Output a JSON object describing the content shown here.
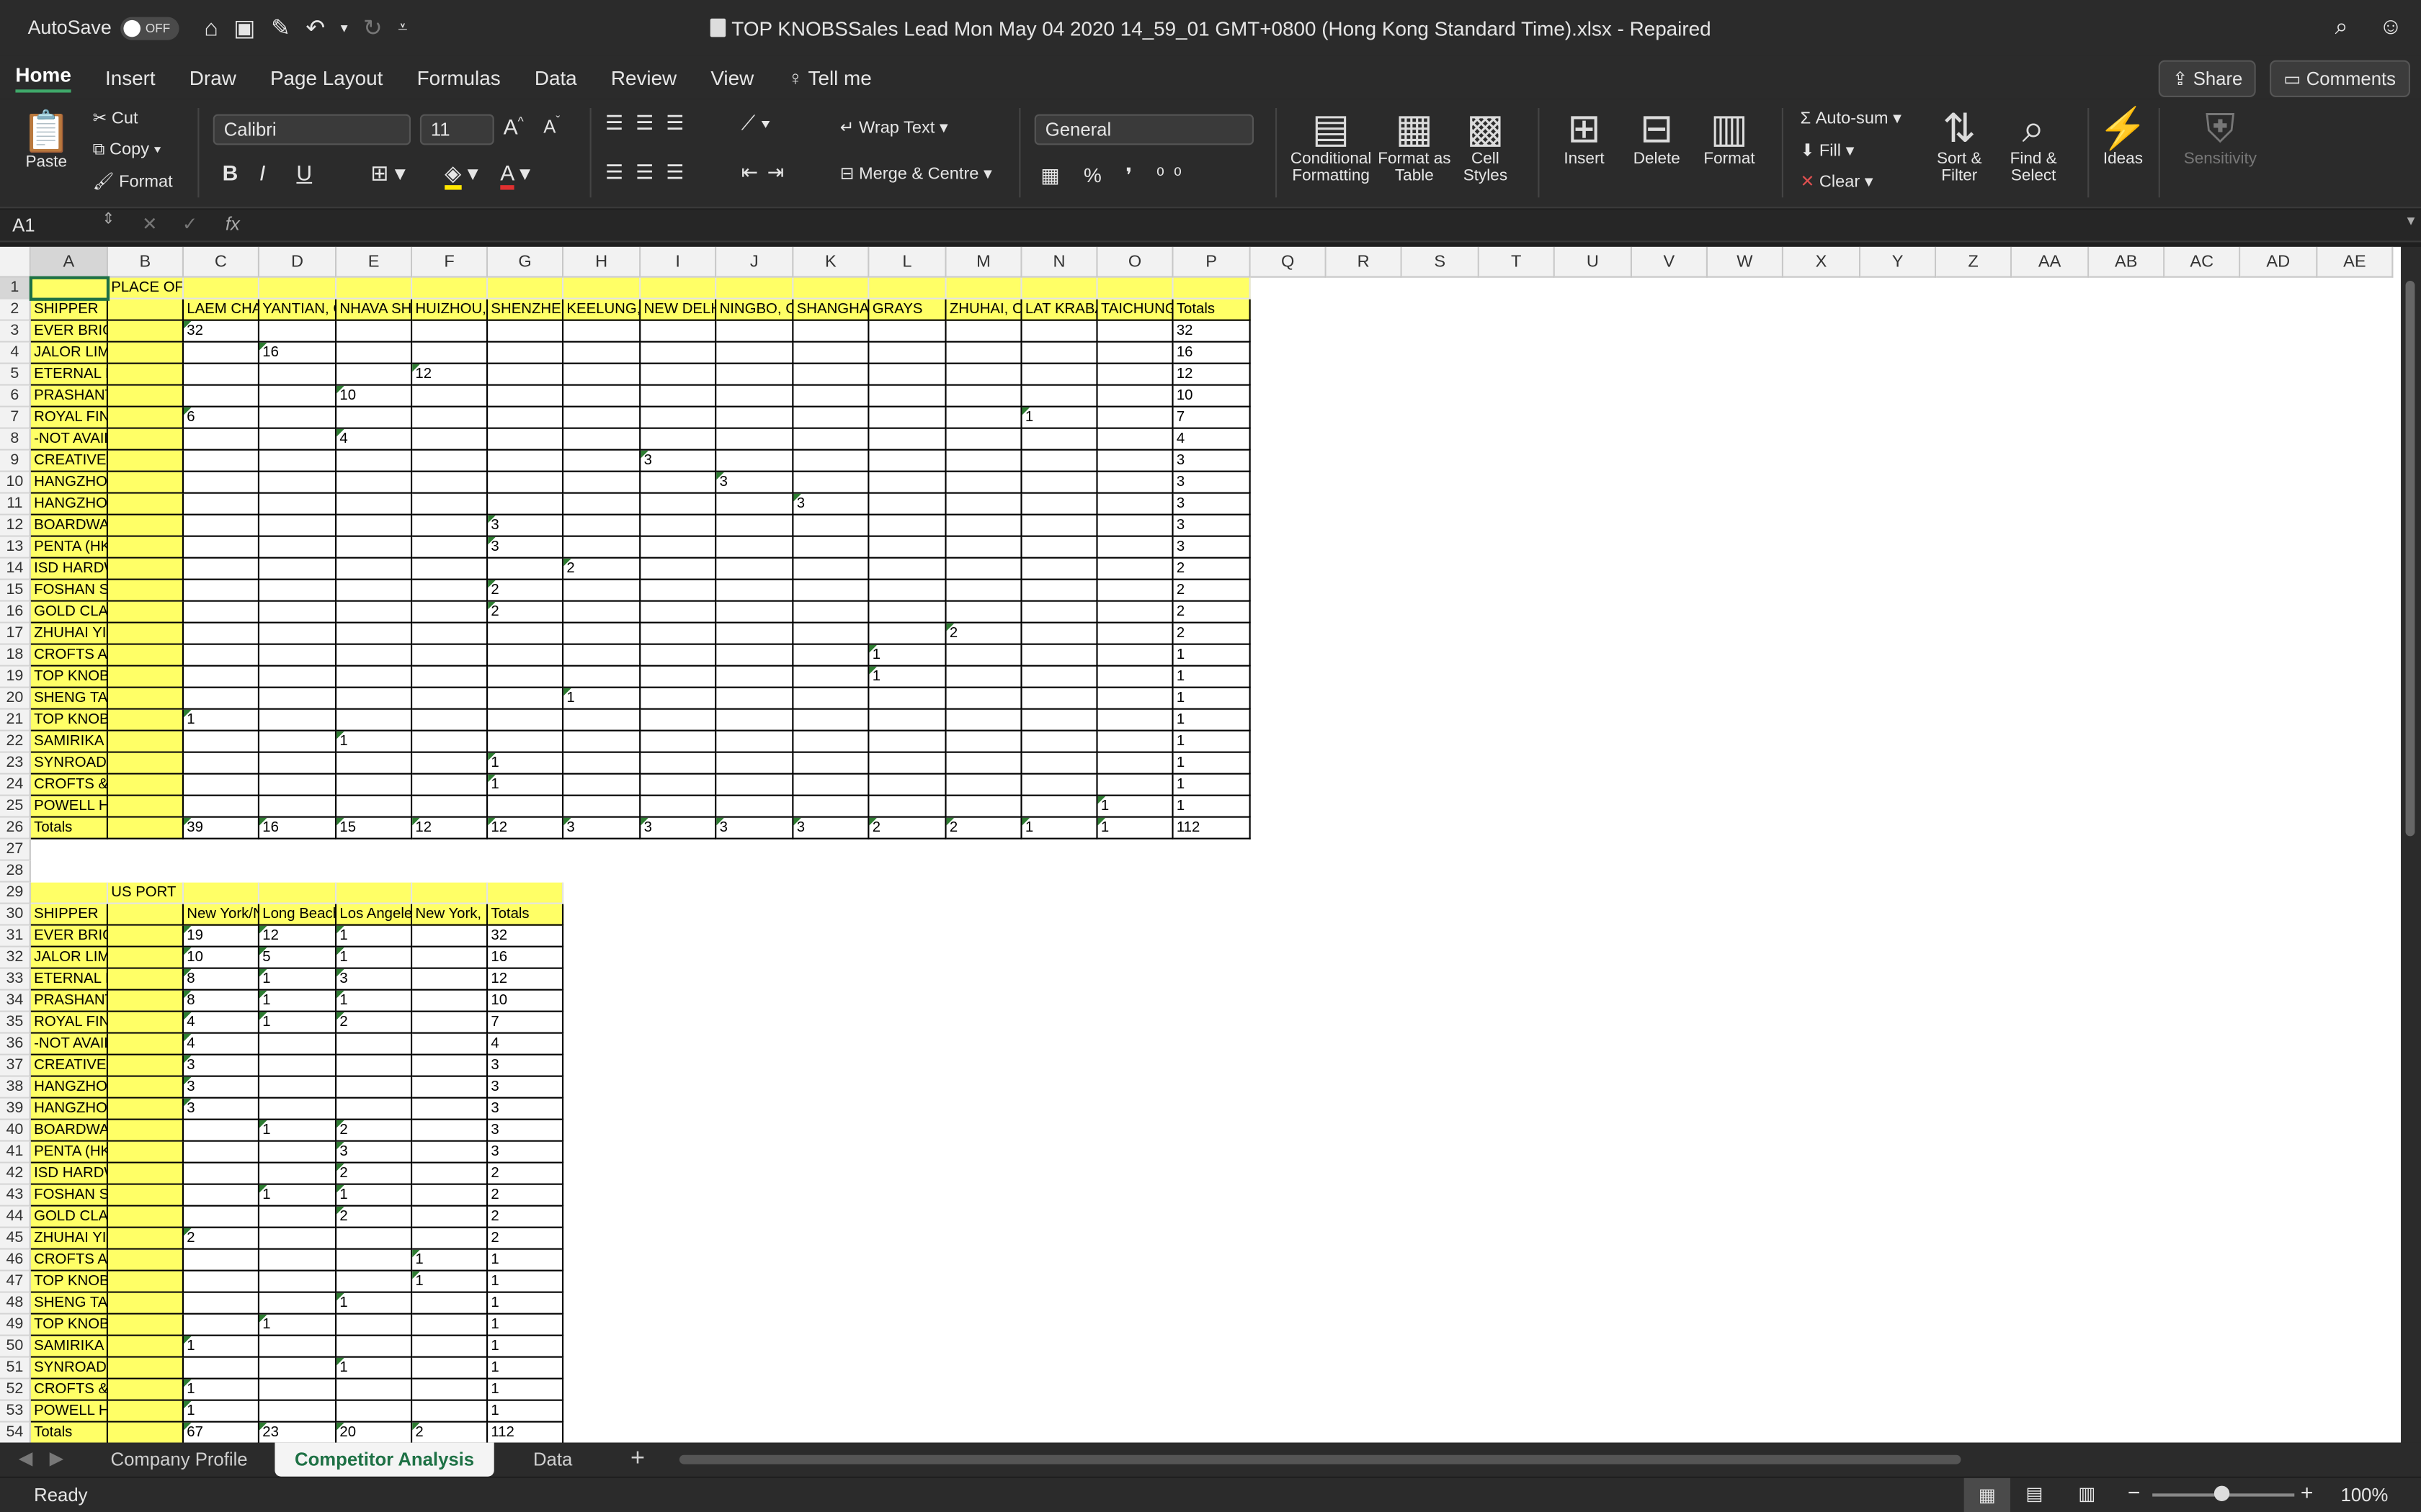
{
  "titlebar": {
    "autosave_label": "AutoSave",
    "autosave_state": "OFF",
    "title": "TOP KNOBSSales Lead Mon May 04 2020 14_59_01 GMT+0800 (Hong Kong Standard Time).xlsx  -  Repaired"
  },
  "menu": {
    "tabs": [
      "Home",
      "Insert",
      "Draw",
      "Page Layout",
      "Formulas",
      "Data",
      "Review",
      "View"
    ],
    "tell_me": "Tell me",
    "share": "Share",
    "comments": "Comments"
  },
  "ribbon": {
    "paste": "Paste",
    "cut": "Cut",
    "copy": "Copy",
    "format": "Format",
    "font_name": "Calibri",
    "font_size": "11",
    "bold": "B",
    "italic": "I",
    "underline": "U",
    "wrap_text": "Wrap Text",
    "merge": "Merge & Centre",
    "number_format": "General",
    "conditional_formatting": "Conditional Formatting",
    "format_as_table": "Format as Table",
    "cell_styles": "Cell Styles",
    "insert": "Insert",
    "delete": "Delete",
    "format_cells": "Format",
    "autosum": "Auto-sum",
    "fill": "Fill",
    "clear": "Clear",
    "sort_filter": "Sort & Filter",
    "find_select": "Find & Select",
    "ideas": "Ideas",
    "sensitivity": "Sensitivity"
  },
  "formula_bar": {
    "name_box": "A1",
    "fx": "fx",
    "content": ""
  },
  "columns": [
    "A",
    "B",
    "C",
    "D",
    "E",
    "F",
    "G",
    "H",
    "I",
    "J",
    "K",
    "L",
    "M",
    "N",
    "O",
    "P",
    "Q",
    "R",
    "S",
    "T",
    "U",
    "V",
    "W",
    "X",
    "Y",
    "Z",
    "AA",
    "AB",
    "AC",
    "AD",
    "AE"
  ],
  "table1": {
    "header_label": "PLACE OF R",
    "shipper_label": "SHIPPER",
    "ports": [
      "LAEM CHAB",
      "YANTIAN, C",
      "NHAVA SHE",
      "HUIZHOU,C",
      "SHENZHEN",
      "KEELUNG, T",
      "NEW DELHI",
      "NINGBO, CI",
      "SHANGHAI,",
      "GRAYS",
      "ZHUHAI, CH",
      "LAT KRABA",
      "TAICHUNG,",
      "Totals"
    ],
    "rows": [
      {
        "shipper": "EVER BRIGHT INDUSTRI",
        "vals": [
          "32",
          "",
          "",
          "",
          "",
          "",
          "",
          "",
          "",
          "",
          "",
          "",
          "",
          "32"
        ]
      },
      {
        "shipper": "JALOR LIMITED",
        "vals": [
          "",
          "16",
          "",
          "",
          "",
          "",
          "",
          "",
          "",
          "",
          "",
          "",
          "",
          "16"
        ]
      },
      {
        "shipper": "ETERNAL DRAGON INTE",
        "vals": [
          "",
          "",
          "",
          "12",
          "",
          "",
          "",
          "",
          "",
          "",
          "",
          "",
          "",
          "12"
        ]
      },
      {
        "shipper": "PRASHANT ENTERPRISE",
        "vals": [
          "",
          "",
          "10",
          "",
          "",
          "",
          "",
          "",
          "",
          "",
          "",
          "",
          "",
          "10"
        ]
      },
      {
        "shipper": "ROYAL FINISHING CO.,L",
        "vals": [
          "6",
          "",
          "",
          "",
          "",
          "",
          "",
          "",
          "",
          "",
          "",
          "1",
          "",
          "7"
        ]
      },
      {
        "shipper": "-NOT AVAILABLE-",
        "vals": [
          "",
          "",
          "4",
          "",
          "",
          "",
          "",
          "",
          "",
          "",
          "",
          "",
          "",
          "4"
        ]
      },
      {
        "shipper": "CREATIVE & CROFTS IND",
        "vals": [
          "",
          "",
          "",
          "",
          "",
          "",
          "3",
          "",
          "",
          "",
          "",
          "",
          "",
          "3"
        ]
      },
      {
        "shipper": "HANGZHOU HAOSOON",
        "vals": [
          "",
          "",
          "",
          "",
          "",
          "",
          "",
          "3",
          "",
          "",
          "",
          "",
          "",
          "3"
        ]
      },
      {
        "shipper": "HANGZHOU ADVANCE H",
        "vals": [
          "",
          "",
          "",
          "",
          "",
          "",
          "",
          "",
          "3",
          "",
          "",
          "",
          "",
          "3"
        ]
      },
      {
        "shipper": "BOARDWALK HOME FU",
        "vals": [
          "",
          "",
          "",
          "",
          "3",
          "",
          "",
          "",
          "",
          "",
          "",
          "",
          "",
          "3"
        ]
      },
      {
        "shipper": "PENTA (HK) COMPANY L",
        "vals": [
          "",
          "",
          "",
          "",
          "3",
          "",
          "",
          "",
          "",
          "",
          "",
          "",
          "",
          "3"
        ]
      },
      {
        "shipper": "ISD HARDWARE CO., LT",
        "vals": [
          "",
          "",
          "",
          "",
          "",
          "2",
          "",
          "",
          "",
          "",
          "",
          "",
          "",
          "2"
        ]
      },
      {
        "shipper": "FOSHAN SHUNDE DISTR",
        "vals": [
          "",
          "",
          "",
          "",
          "2",
          "",
          "",
          "",
          "",
          "",
          "",
          "",
          "",
          "2"
        ]
      },
      {
        "shipper": "GOLD CLASSIC ENTERPR",
        "vals": [
          "",
          "",
          "",
          "",
          "2",
          "",
          "",
          "",
          "",
          "",
          "",
          "",
          "",
          "2"
        ]
      },
      {
        "shipper": "ZHUHAI YIJIA CRYSTAL C",
        "vals": [
          "",
          "",
          "",
          "",
          "",
          "",
          "",
          "",
          "",
          "",
          "2",
          "",
          "",
          "2"
        ]
      },
      {
        "shipper": "CROFTS AND ASSINDER",
        "vals": [
          "",
          "",
          "",
          "",
          "",
          "",
          "",
          "",
          "",
          "1",
          "",
          "",
          "",
          "1"
        ]
      },
      {
        "shipper": "TOP KNOBS LTD",
        "vals": [
          "",
          "",
          "",
          "",
          "",
          "",
          "",
          "",
          "",
          "1",
          "",
          "",
          "",
          "1"
        ]
      },
      {
        "shipper": "SHENG TAI BRASSWARE",
        "vals": [
          "",
          "",
          "",
          "",
          "",
          "1",
          "",
          "",
          "",
          "",
          "",
          "",
          "",
          "1"
        ]
      },
      {
        "shipper": "TOP KNOBS, INC.",
        "vals": [
          "1",
          "",
          "",
          "",
          "",
          "",
          "",
          "",
          "",
          "",
          "",
          "",
          "",
          "1"
        ]
      },
      {
        "shipper": "SAMIRIKA EXPORTS,",
        "vals": [
          "",
          "",
          "1",
          "",
          "",
          "",
          "",
          "",
          "",
          "",
          "",
          "",
          "",
          "1"
        ]
      },
      {
        "shipper": "SYNROAD HARDWARE I",
        "vals": [
          "",
          "",
          "",
          "",
          "1",
          "",
          "",
          "",
          "",
          "",
          "",
          "",
          "",
          "1"
        ]
      },
      {
        "shipper": "CROFTS & ASSINDER LT",
        "vals": [
          "",
          "",
          "",
          "",
          "1",
          "",
          "",
          "",
          "",
          "",
          "",
          "",
          "",
          "1"
        ]
      },
      {
        "shipper": "POWELL HARDWARE CO",
        "vals": [
          "",
          "",
          "",
          "",
          "",
          "",
          "",
          "",
          "",
          "",
          "",
          "",
          "1",
          "1"
        ]
      }
    ],
    "totals_label": "Totals",
    "totals": [
      "39",
      "16",
      "15",
      "12",
      "12",
      "3",
      "3",
      "3",
      "3",
      "2",
      "2",
      "1",
      "1",
      "112"
    ]
  },
  "table2": {
    "header_label": "US PORT",
    "shipper_label": "SHIPPER",
    "ports": [
      "New York/N",
      "Long Beach",
      "Los Angeles",
      "New York, N",
      "Totals"
    ],
    "rows": [
      {
        "shipper": "EVER BRIGHT INDUSTRI",
        "vals": [
          "19",
          "12",
          "1",
          "",
          "32"
        ]
      },
      {
        "shipper": "JALOR LIMITED",
        "vals": [
          "10",
          "5",
          "1",
          "",
          "16"
        ]
      },
      {
        "shipper": "ETERNAL DRAGON INTE",
        "vals": [
          "8",
          "1",
          "3",
          "",
          "12"
        ]
      },
      {
        "shipper": "PRASHANT ENTERPRISE",
        "vals": [
          "8",
          "1",
          "1",
          "",
          "10"
        ]
      },
      {
        "shipper": "ROYAL FINISHING CO.,L",
        "vals": [
          "4",
          "1",
          "2",
          "",
          "7"
        ]
      },
      {
        "shipper": "-NOT AVAILABLE-",
        "vals": [
          "4",
          "",
          "",
          "",
          "4"
        ]
      },
      {
        "shipper": "CREATIVE & CROFTS IND",
        "vals": [
          "3",
          "",
          "",
          "",
          "3"
        ]
      },
      {
        "shipper": "HANGZHOU HAOSOON",
        "vals": [
          "3",
          "",
          "",
          "",
          "3"
        ]
      },
      {
        "shipper": "HANGZHOU ADVANCE H",
        "vals": [
          "3",
          "",
          "",
          "",
          "3"
        ]
      },
      {
        "shipper": "BOARDWALK HOME FU",
        "vals": [
          "",
          "1",
          "2",
          "",
          "3"
        ]
      },
      {
        "shipper": "PENTA (HK) COMPANY L",
        "vals": [
          "",
          "",
          "3",
          "",
          "3"
        ]
      },
      {
        "shipper": "ISD HARDWARE CO., LT",
        "vals": [
          "",
          "",
          "2",
          "",
          "2"
        ]
      },
      {
        "shipper": "FOSHAN SHUNDE DISTR",
        "vals": [
          "",
          "1",
          "1",
          "",
          "2"
        ]
      },
      {
        "shipper": "GOLD CLASSIC ENTERPR",
        "vals": [
          "",
          "",
          "2",
          "",
          "2"
        ]
      },
      {
        "shipper": "ZHUHAI YIJIA CRYSTAL C",
        "vals": [
          "2",
          "",
          "",
          "",
          "2"
        ]
      },
      {
        "shipper": "CROFTS AND ASSINDER",
        "vals": [
          "",
          "",
          "",
          "1",
          "1"
        ]
      },
      {
        "shipper": "TOP KNOBS LTD",
        "vals": [
          "",
          "",
          "",
          "1",
          "1"
        ]
      },
      {
        "shipper": "SHENG TAI BRASSWARE",
        "vals": [
          "",
          "",
          "1",
          "",
          "1"
        ]
      },
      {
        "shipper": "TOP KNOBS, INC.",
        "vals": [
          "",
          "1",
          "",
          "",
          "1"
        ]
      },
      {
        "shipper": "SAMIRIKA EXPORTS,",
        "vals": [
          "1",
          "",
          "",
          "",
          "1"
        ]
      },
      {
        "shipper": "SYNROAD HARDWARE I",
        "vals": [
          "",
          "",
          "1",
          "",
          "1"
        ]
      },
      {
        "shipper": "CROFTS & ASSINDER LT",
        "vals": [
          "1",
          "",
          "",
          "",
          "1"
        ]
      },
      {
        "shipper": "POWELL HARDWARE CO",
        "vals": [
          "1",
          "",
          "",
          "",
          "1"
        ]
      }
    ],
    "totals_label": "Totals",
    "totals": [
      "67",
      "23",
      "20",
      "2",
      "112"
    ]
  },
  "sheet_tabs": [
    "Company Profile",
    "Competitor Analysis",
    "Data"
  ],
  "active_sheet": "Competitor Analysis",
  "status": {
    "ready": "Ready",
    "zoom": "100%"
  },
  "colors": {
    "accent": "#1e7145",
    "highlight": "#ffff66",
    "chrome": "#2b2b2b"
  }
}
